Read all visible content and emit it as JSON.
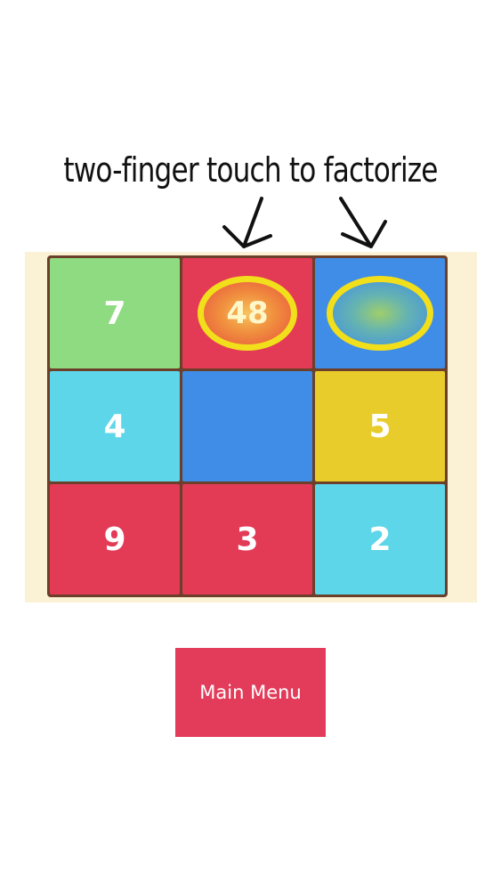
{
  "hint": {
    "text": "two-finger touch to factorize"
  },
  "board": {
    "tiles": [
      {
        "label": "7",
        "color": "#8fdb82",
        "ring": false
      },
      {
        "label": "48",
        "color": "#e33a56",
        "ring": true
      },
      {
        "label": "",
        "color": "#3f8de6",
        "ring": true
      },
      {
        "label": "4",
        "color": "#5cd6e8",
        "ring": false
      },
      {
        "label": "",
        "color": "#3f8de6",
        "ring": false
      },
      {
        "label": "5",
        "color": "#e8cc2c",
        "ring": false
      },
      {
        "label": "9",
        "color": "#e33a56",
        "ring": false
      },
      {
        "label": "3",
        "color": "#e33a56",
        "ring": false
      },
      {
        "label": "2",
        "color": "#5cd6e8",
        "ring": false
      }
    ],
    "ring_color": "#f2df1b",
    "border_color": "#6b3f2a",
    "background_color": "#fbf1d4"
  },
  "menu": {
    "main_menu_label": "Main Menu",
    "button_color": "#e23c5a"
  }
}
